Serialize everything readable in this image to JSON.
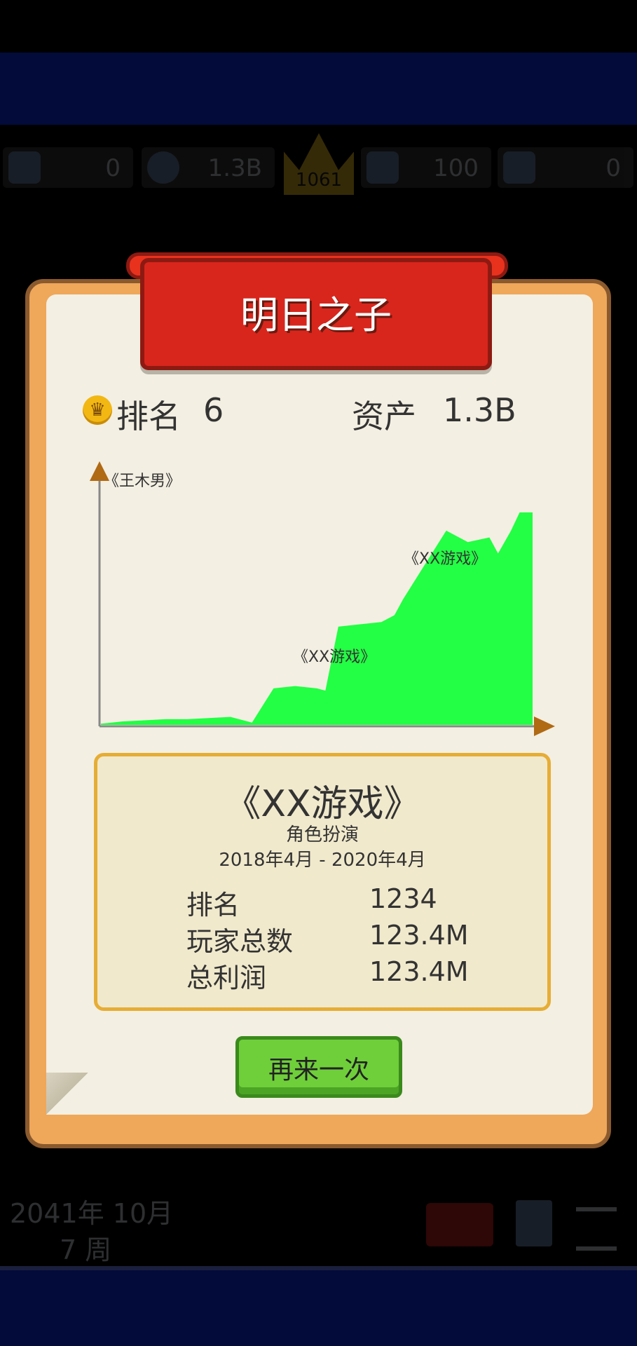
{
  "hud": {
    "trophies": "0",
    "money": "1.3B",
    "crown_score": "1061",
    "fans": "100",
    "other": "0"
  },
  "bottom_hud": {
    "date": "2041年 10月",
    "week": "7 周"
  },
  "modal": {
    "title": "明日之子",
    "rank_label": "排名",
    "rank_value": "6",
    "assets_label": "资产",
    "assets_value": "1.3B"
  },
  "chart_data": {
    "type": "area",
    "title": "",
    "color": "#22ff44",
    "annotations": [
      {
        "text": "《王木男》"
      },
      {
        "text": "《XX游戏》"
      },
      {
        "text": "《XX游戏》"
      }
    ],
    "x": [
      0,
      5,
      10,
      15,
      20,
      25,
      30,
      35,
      40,
      45,
      50,
      52,
      55,
      60,
      65,
      68,
      70,
      75,
      80,
      85,
      90,
      92,
      95,
      97,
      100
    ],
    "values": [
      0.5,
      1.5,
      2.0,
      2.5,
      2.5,
      3.0,
      3.5,
      1.0,
      16,
      17,
      16,
      15,
      43,
      44,
      45,
      48,
      55,
      70,
      85,
      80,
      82,
      75,
      85,
      93,
      93
    ]
  },
  "game": {
    "title": "《XX游戏》",
    "genre": "角色扮演",
    "dates": "2018年4月 - 2020年4月",
    "rows": [
      {
        "label": "排名",
        "value": "1234"
      },
      {
        "label": "玩家总数",
        "value": "123.4M"
      },
      {
        "label": "总利润",
        "value": "123.4M"
      }
    ]
  },
  "retry_button": "再来一次",
  "icons": {
    "crown": "crown-icon",
    "trophy": "trophy-icon",
    "money_bag": "money-bag-icon",
    "fans": "fans-icon",
    "book": "book-icon",
    "settings": "sliders-icon"
  }
}
